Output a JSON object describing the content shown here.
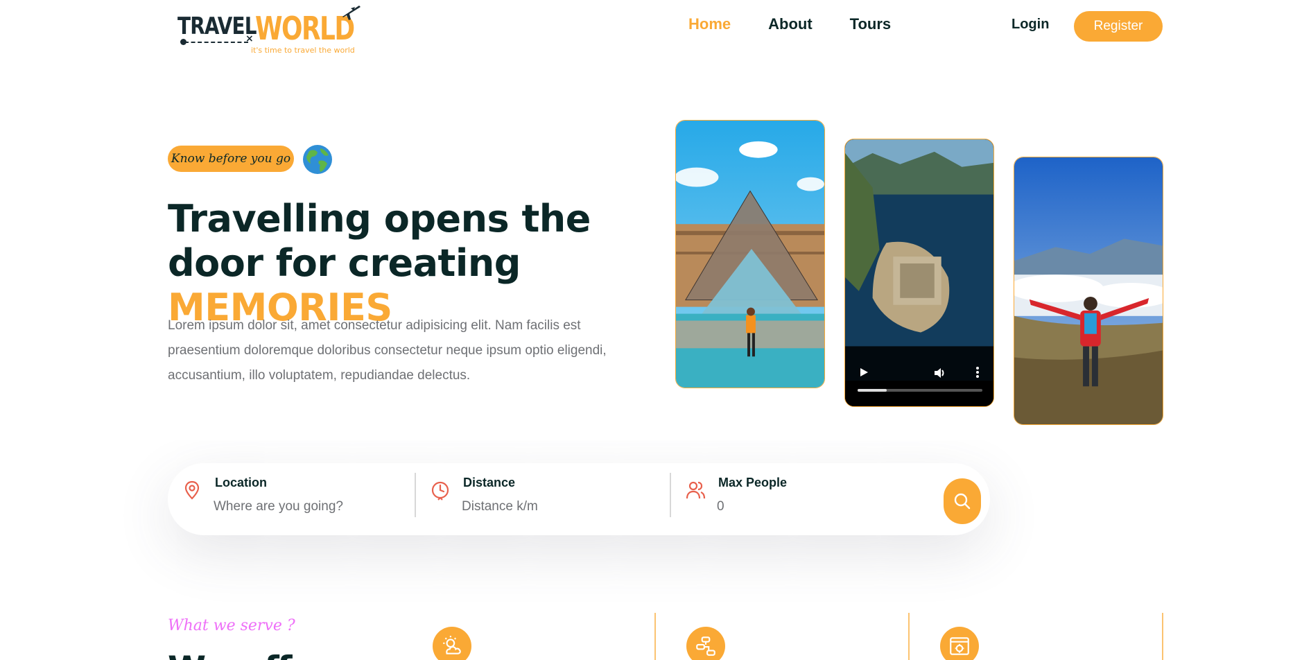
{
  "logo": {
    "word1": "TRAVEL",
    "word2": "WORLD",
    "tagline": "it's time to travel the world"
  },
  "nav": {
    "items": [
      {
        "label": "Home",
        "active": true
      },
      {
        "label": "About",
        "active": false
      },
      {
        "label": "Tours",
        "active": false
      }
    ],
    "login": "Login",
    "register": "Register"
  },
  "hero": {
    "badge": "Know before you go",
    "title_part1": "Travelling opens the door for creating ",
    "title_highlight": "MEMORIES",
    "description": "Lorem ipsum dolor sit, amet consectetur adipisicing elit. Nam facilis est praesentium doloremque doloribus consectetur neque ipsum optio eligendi, accusantium, illo voluptatem, repudiandae delectus."
  },
  "search": {
    "location": {
      "label": "Location",
      "placeholder": "Where are you going?"
    },
    "distance": {
      "label": "Distance",
      "placeholder": "Distance k/m"
    },
    "people": {
      "label": "Max People",
      "placeholder": "0"
    }
  },
  "services": {
    "subtitle": "What we serve ?",
    "title": "We offer our"
  },
  "colors": {
    "accent": "#faa935",
    "heading": "#0b2727",
    "text": "#6e7074",
    "subtitle": "#ee6ff8",
    "icon_red": "#e8604c"
  },
  "icons": [
    "airplane-icon",
    "globe-icon",
    "location-pin-icon",
    "clock-icon",
    "people-icon",
    "search-icon",
    "weather-icon",
    "guide-icon",
    "customization-icon",
    "play-icon",
    "volume-icon",
    "more-icon"
  ]
}
